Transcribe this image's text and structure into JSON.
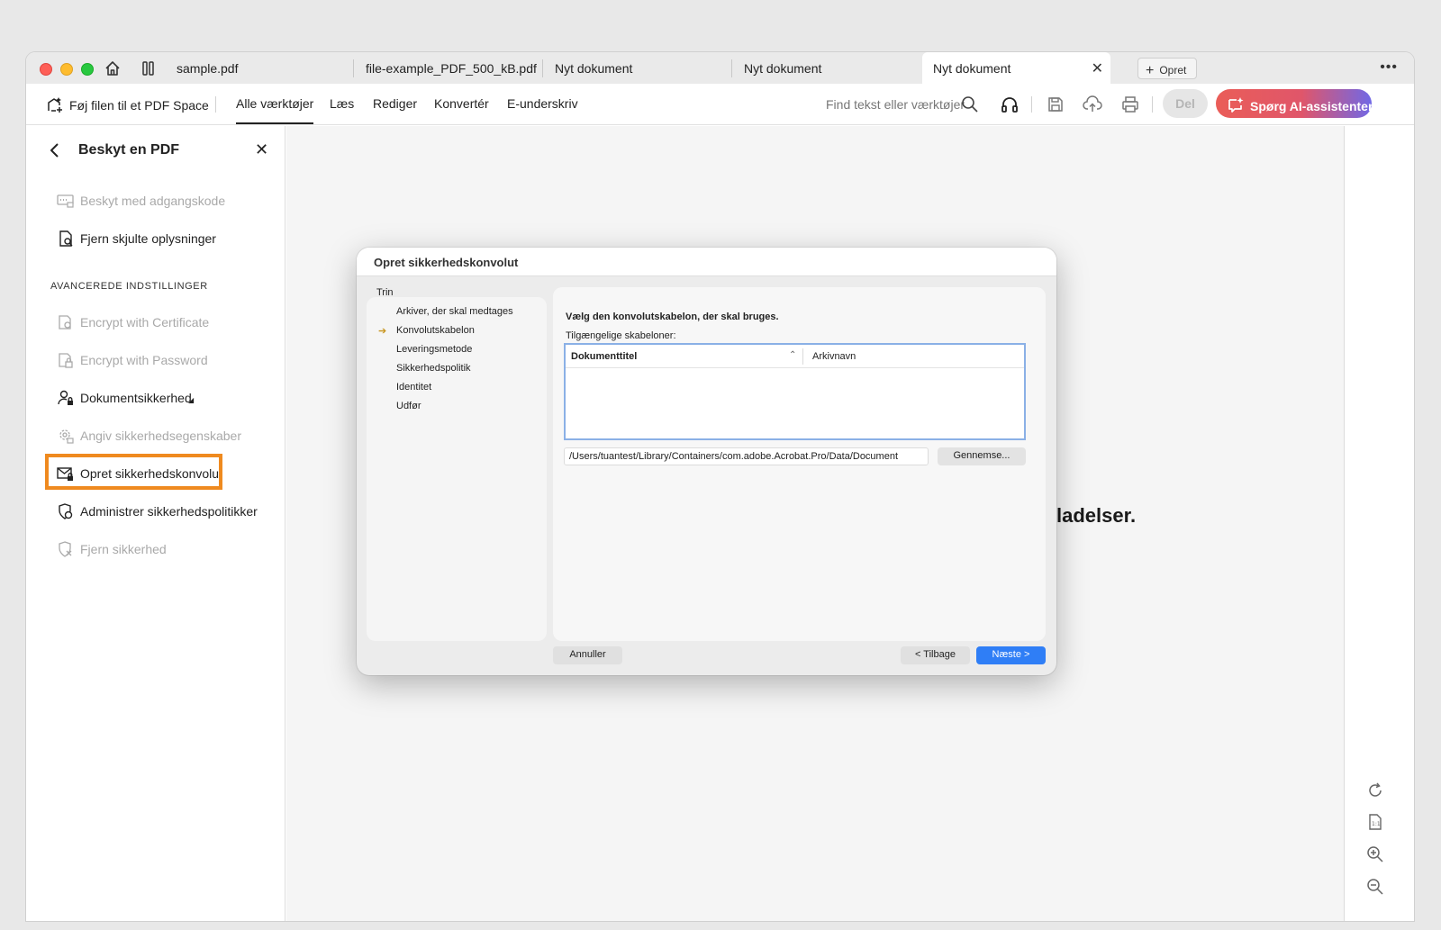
{
  "tabs": [
    {
      "label": "sample.pdf"
    },
    {
      "label": "file-example_PDF_500_kB.pdf"
    },
    {
      "label": "Nyt dokument"
    },
    {
      "label": "Nyt dokument"
    },
    {
      "label": "Nyt dokument",
      "active": true
    }
  ],
  "new_tab_label": "Opret",
  "toolbar": {
    "add_to_space": "Føj filen til et PDF Space",
    "menus": [
      "Alle værktøjer",
      "Læs",
      "Rediger",
      "Konvertér",
      "E-underskriv"
    ],
    "search_placeholder": "Find tekst eller værktøjer",
    "share_label": "Del",
    "ai_label": "Spørg AI-assistenten",
    "ai_gradient": [
      "#ea5d58",
      "#7068e6"
    ]
  },
  "sidebar": {
    "title": "Beskyt en PDF",
    "items_top": [
      {
        "label": "Beskyt med adgangskode",
        "enabled": false,
        "icon": "password-field-icon"
      },
      {
        "label": "Fjern skjulte oplysninger",
        "enabled": true,
        "icon": "document-search-icon"
      }
    ],
    "section_label": "AVANCEREDE INDSTILLINGER",
    "items_advanced": [
      {
        "label": "Encrypt with Certificate",
        "enabled": false,
        "icon": "certificate-lock-icon"
      },
      {
        "label": "Encrypt with Password",
        "enabled": false,
        "icon": "password-lock-icon"
      },
      {
        "label": "Dokumentsikkerhed",
        "enabled": true,
        "icon": "user-lock-icon"
      },
      {
        "label": "Angiv sikkerhedsegenskaber",
        "enabled": false,
        "icon": "gear-lock-icon"
      },
      {
        "label": "Opret sikkerhedskonvolut",
        "enabled": true,
        "icon": "envelope-lock-icon",
        "highlighted": true
      },
      {
        "label": "Administrer sikkerhedspolitikker",
        "enabled": true,
        "icon": "policy-shield-icon"
      },
      {
        "label": "Fjern sikkerhed",
        "enabled": false,
        "icon": "shield-remove-icon"
      }
    ],
    "highlight_color": "#ef8a1f"
  },
  "document": {
    "visible_text": "ladelser."
  },
  "dialog": {
    "title": "Opret sikkerhedskonvolut",
    "steps_label": "Trin",
    "steps": [
      {
        "label": "Arkiver, der skal medtages",
        "current": false
      },
      {
        "label": "Konvolutskabelon",
        "current": true
      },
      {
        "label": "Leveringsmetode",
        "current": false
      },
      {
        "label": "Sikkerhedspolitik",
        "current": false
      },
      {
        "label": "Identitet",
        "current": false
      },
      {
        "label": "Udfør",
        "current": false
      }
    ],
    "heading": "Vælg den konvolutskabelon, der skal bruges.",
    "subheading": "Tilgængelige skabeloner:",
    "table": {
      "columns": [
        "Dokumenttitel",
        "Arkivnavn"
      ],
      "rows": []
    },
    "path_value": "/Users/tuantest/Library/Containers/com.adobe.Acrobat.Pro/Data/Document",
    "browse_label": "Gennemse...",
    "cancel_label": "Annuller",
    "back_label": "< Tilbage",
    "next_label": "Næste >",
    "accent_color": "#2f7ef6"
  }
}
